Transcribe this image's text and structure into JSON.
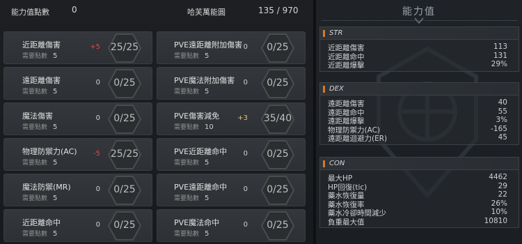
{
  "topbar": {
    "points_label": "能力值點數",
    "points_value": "0",
    "range_label": "哈芙萬能圓",
    "range_value": "135 / 970"
  },
  "cost_label": "需要點數",
  "left_column": [
    {
      "name": "近距離傷害",
      "cost": "5",
      "bonus": "+5",
      "bonus_color": "#d84a4a",
      "value": "25/25"
    },
    {
      "name": "遠距離傷害",
      "cost": "5",
      "bonus": "0",
      "bonus_color": "#d0d0d0",
      "value": "0/25"
    },
    {
      "name": "魔法傷害",
      "cost": "5",
      "bonus": "0",
      "bonus_color": "#d0d0d0",
      "value": "0/25"
    },
    {
      "name": "物理防禦力(AC)",
      "cost": "5",
      "bonus": "-5",
      "bonus_color": "#d84a4a",
      "value": "25/25"
    },
    {
      "name": "魔法防禦(MR)",
      "cost": "5",
      "bonus": "0",
      "bonus_color": "#d0d0d0",
      "value": "0/25"
    },
    {
      "name": "近距離命中",
      "cost": "5",
      "bonus": "0",
      "bonus_color": "#d0d0d0",
      "value": "0/25"
    }
  ],
  "right_column": [
    {
      "name": "PVE遠距離附加傷害",
      "cost": "5",
      "bonus": "0",
      "bonus_color": "#d0d0d0",
      "value": "0/25"
    },
    {
      "name": "PVE魔法附加傷害",
      "cost": "5",
      "bonus": "0",
      "bonus_color": "#d0d0d0",
      "value": "0/25"
    },
    {
      "name": "PVE傷害減免",
      "cost": "10",
      "bonus": "+3",
      "bonus_color": "#d9c87a",
      "value": "35/40"
    },
    {
      "name": "PVE近距離命中",
      "cost": "5",
      "bonus": "0",
      "bonus_color": "#d0d0d0",
      "value": "0/25"
    },
    {
      "name": "PVE遠距離命中",
      "cost": "5",
      "bonus": "0",
      "bonus_color": "#d0d0d0",
      "value": "0/25"
    },
    {
      "name": "PVE魔法命中",
      "cost": "5",
      "bonus": "0",
      "bonus_color": "#d0d0d0",
      "value": "0/25"
    }
  ],
  "stats_panel": {
    "title": "能力值",
    "accent_color": "#d27a2c",
    "sections": [
      {
        "label": "STR",
        "rows": [
          {
            "k": "近距離傷害",
            "v": "113"
          },
          {
            "k": "近距離命中",
            "v": "131"
          },
          {
            "k": "近距離爆擊",
            "v": "29%"
          }
        ]
      },
      {
        "label": "DEX",
        "rows": [
          {
            "k": "遠距離傷害",
            "v": "40"
          },
          {
            "k": "遠距離命中",
            "v": "55"
          },
          {
            "k": "遠距離爆擊",
            "v": "3%"
          },
          {
            "k": "物理防禦力(AC)",
            "v": "-165"
          },
          {
            "k": "遠距離迴避力(ER)",
            "v": "45"
          }
        ]
      },
      {
        "label": "CON",
        "rows": [
          {
            "k": "最大HP",
            "v": "4462"
          },
          {
            "k": "HP回復(tic)",
            "v": "29"
          },
          {
            "k": "藥水恢復量",
            "v": "22"
          },
          {
            "k": "藥水恢復率",
            "v": "26%"
          },
          {
            "k": "藥水冷卻時間減少",
            "v": "10%"
          },
          {
            "k": "負重最大值",
            "v": "10810"
          }
        ]
      }
    ]
  }
}
